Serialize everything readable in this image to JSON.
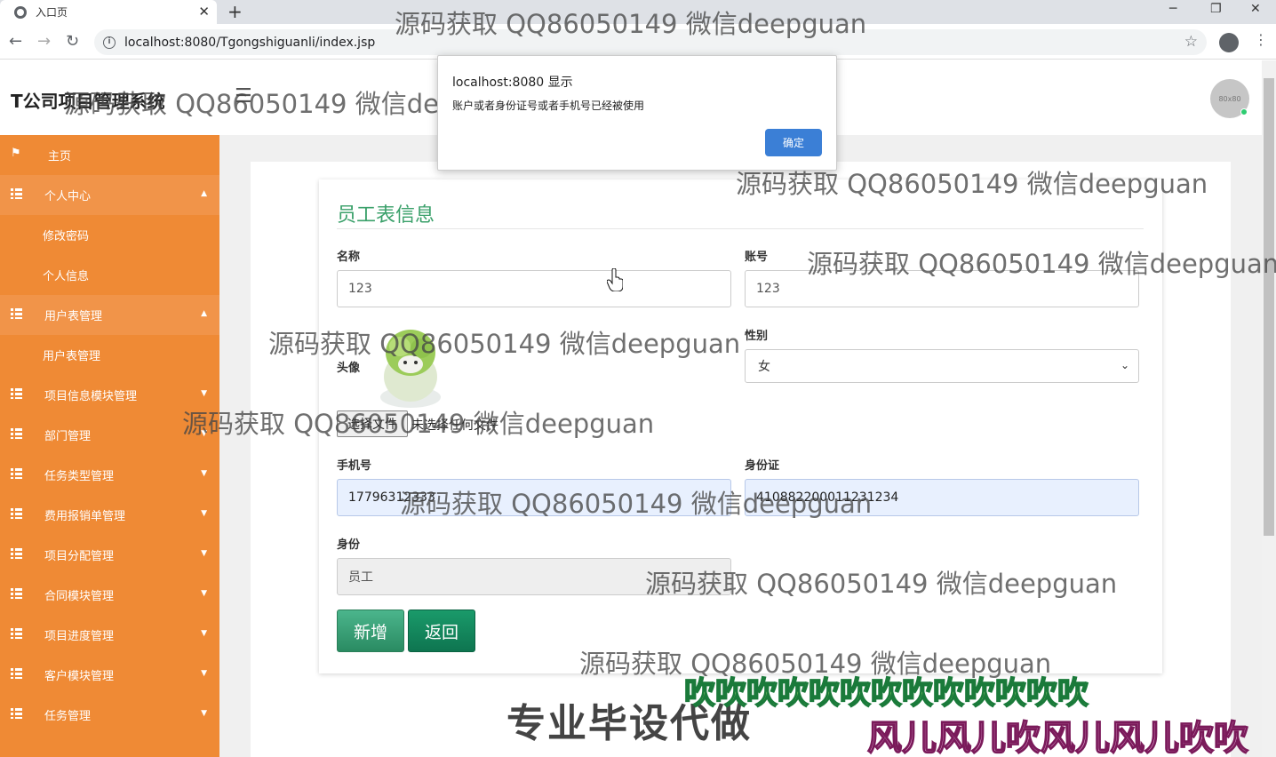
{
  "browser": {
    "tab_title": "入口页",
    "url": "localhost:8080/Tgongshiguanli/index.jsp"
  },
  "header": {
    "brand": "T公司项目管理系统",
    "avatar_text": "80x80"
  },
  "sidebar": {
    "items": [
      {
        "label": "主页"
      },
      {
        "label": "个人中心"
      },
      {
        "label": "修改密码"
      },
      {
        "label": "个人信息"
      },
      {
        "label": "用户表管理"
      },
      {
        "label": "用户表管理"
      },
      {
        "label": "项目信息模块管理"
      },
      {
        "label": "部门管理"
      },
      {
        "label": "任务类型管理"
      },
      {
        "label": "费用报销单管理"
      },
      {
        "label": "项目分配管理"
      },
      {
        "label": "合同模块管理"
      },
      {
        "label": "项目进度管理"
      },
      {
        "label": "客户模块管理"
      },
      {
        "label": "任务管理"
      }
    ]
  },
  "form": {
    "title": "员工表信息",
    "name_label": "名称",
    "name_value": "123",
    "account_label": "账号",
    "account_value": "123",
    "gender_label": "性别",
    "gender_value": "女",
    "avatar_label": "头像",
    "file_button": "选择文件",
    "file_status": "未选择任何文件",
    "phone_label": "手机号",
    "phone_value": "17796312333",
    "idcard_label": "身份证",
    "idcard_value": "410882200011231234",
    "role_label": "身份",
    "role_value": "员工",
    "add_button": "新增",
    "back_button": "返回"
  },
  "alert": {
    "title": "localhost:8080 显示",
    "message": "账户或者身份证号或者手机号已经被使用",
    "ok_button": "确定"
  },
  "overlay": {
    "watermark": "源码获取 QQ86050149 微信deepguan",
    "promo_main": "专业毕设代做",
    "promo_green": "吹吹吹吹吹吹吹吹吹吹吹吹吹",
    "promo_pink": "风儿风儿吹风儿风儿吹吹"
  },
  "colors": {
    "sidebar": "#ef8a35",
    "accent_green": "#3aa06a",
    "alert_button": "#3b7fd6"
  }
}
